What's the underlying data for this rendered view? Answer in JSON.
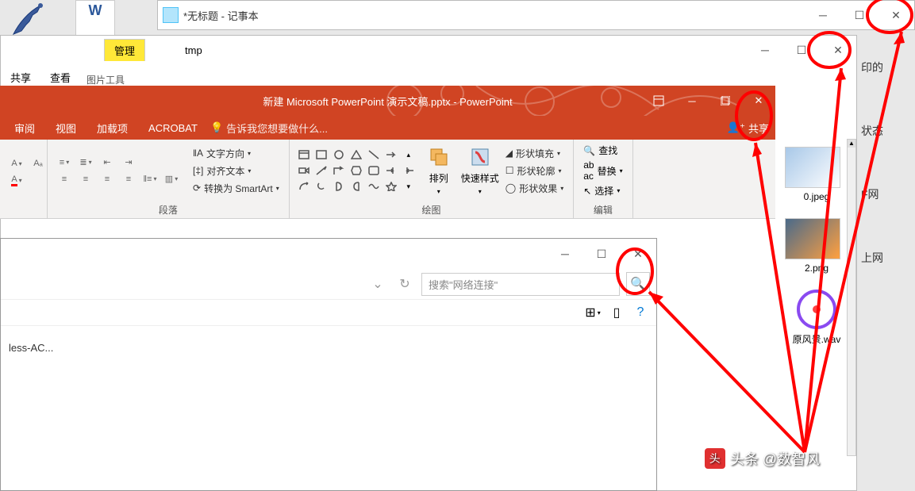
{
  "notepad": {
    "title": "*无标题 - 记事本"
  },
  "explorer": {
    "title": "tmp",
    "ribbon_tab": "管理",
    "ribbon_sub": "图片工具",
    "tabs": [
      "共享",
      "查看"
    ],
    "files": [
      "0.jpeg",
      "2.png",
      "原风景.wav"
    ]
  },
  "ppt": {
    "title": "新建 Microsoft PowerPoint 演示文稿.pptx - PowerPoint",
    "tabs": [
      "审阅",
      "视图",
      "加载项",
      "ACROBAT"
    ],
    "tell_me": "告诉我您想要做什么...",
    "share": "共享",
    "para_opts": [
      "文字方向",
      "对齐文本",
      "转换为 SmartArt"
    ],
    "group_para": "段落",
    "arrange": "排列",
    "quick_style": "快速样式",
    "shape_fill": "形状填充",
    "shape_outline": "形状轮廓",
    "shape_effects": "形状效果",
    "group_draw": "绘图",
    "find": "查找",
    "replace": "替换",
    "select": "选择",
    "group_edit": "编辑"
  },
  "network": {
    "search_placeholder": "搜索\"网络连接\"",
    "item": "less-AC..."
  },
  "right_labels": [
    "印的",
    "状态",
    "F网",
    "上网"
  ],
  "watermark": "头条 @数智风"
}
